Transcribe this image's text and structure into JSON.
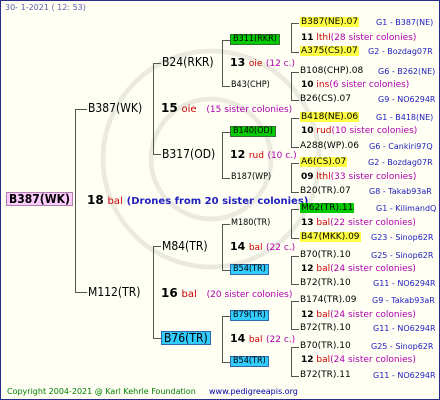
{
  "header": {
    "date": "30-  1-2021  ( 12: 53)"
  },
  "root": {
    "name": "B387(WK)",
    "color": "#ffccff"
  },
  "root_info": {
    "num": "18",
    "word": "bal",
    "note": "(Drones from 20 sister colonies)"
  },
  "gen1": [
    {
      "name": "B387(WK)",
      "num": "15",
      "word": "oie",
      "note": "(15 sister colonies)"
    },
    {
      "name": "M112(TR)",
      "num": "16",
      "word": "bal",
      "note": "(20 sister colonies)"
    }
  ],
  "gen2": [
    {
      "name": "B24(RKR)",
      "num": "13",
      "word": "oie",
      "note": "(12 c.)"
    },
    {
      "name": "B317(OD)",
      "num": "12",
      "word": "rud",
      "note": "(10 c.)"
    },
    {
      "name": "M84(TR)",
      "num": "14",
      "word": "bal",
      "note": "(22 c.)"
    },
    {
      "name": "B76(TR)",
      "num": "14",
      "word": "bal",
      "note": "(22 c.)"
    }
  ],
  "gen3": [
    {
      "name": "B311(RKR)",
      "color": "#00cc00"
    },
    {
      "name": "B43(CHP)"
    },
    {
      "name": "B140(OD)",
      "color": "#00cc00"
    },
    {
      "name": "B187(WP)"
    },
    {
      "name": "M180(TR)"
    },
    {
      "name": "B54(TR)",
      "color": "#33ccff"
    },
    {
      "name": "B79(TR)",
      "color": "#33ccff"
    },
    {
      "name": "B54(TR)",
      "color": "#33ccff"
    }
  ],
  "gen3_info": [
    {
      "num": "11",
      "word": "lthl",
      "note": "(28 sister colonies)"
    },
    {
      "num": "10",
      "word": "ins",
      "note": "(6 sister colonies)"
    },
    {
      "num": "10",
      "word": "rud",
      "note": "(10 sister colonies)"
    },
    {
      "num": "09",
      "word": "lthl",
      "note": "(33 sister colonies)"
    },
    {
      "num": "13",
      "word": "bal",
      "note": "(22 sister colonies)"
    },
    {
      "num": "12",
      "word": "bal",
      "note": "(24 sister colonies)"
    },
    {
      "num": "12",
      "word": "bal",
      "note": "(24 sister colonies)"
    },
    {
      "num": "12",
      "word": "bal",
      "note": "(24 sister colonies)"
    }
  ],
  "gen4": [
    {
      "name": "B387(NE).07",
      "code": "G1 - B387(NE)",
      "color": "#ffff44"
    },
    {
      "name": "A375(CS).07",
      "code": "G2 - Bozdag07R",
      "color": "#ffff44"
    },
    {
      "name": "B108(CHP).08",
      "code": "G6 - B262(NE)"
    },
    {
      "name": "B26(CS).07",
      "code": "G9 - NO6294R"
    },
    {
      "name": "B418(NE).06",
      "code": "G1 - B418(NE)",
      "color": "#ffff44"
    },
    {
      "name": "A288(WP).06",
      "code": "G6 - Cankiri97Q"
    },
    {
      "name": "A6(CS).07",
      "code": "G2 - Bozdag07R",
      "color": "#ffff44"
    },
    {
      "name": "B20(TR).07",
      "code": "G8 - Takab93aR"
    },
    {
      "name": "M62(TR).11",
      "code": "G1 - KilimandQ",
      "color": "#00cc00"
    },
    {
      "name": "B47(MKK).09",
      "code": "G23 - Sinop62R",
      "color": "#ffff44"
    },
    {
      "name": "B70(TR).10",
      "code": "G25 - Sinop62R"
    },
    {
      "name": "B72(TR).10",
      "code": "G11 - NO6294R"
    },
    {
      "name": "B174(TR).09",
      "code": "G9 - Takab93aR"
    },
    {
      "name": "B72(TR).10",
      "code": "G11 - NO6294R"
    },
    {
      "name": "B70(TR).10",
      "code": "G25 - Sinop62R"
    },
    {
      "name": "B72(TR).11",
      "code": "G11 - NO6294R"
    }
  ],
  "footer": {
    "copyright": "Copyright 2004-2021 @ Karl Kehrle Foundation",
    "url": "www.pedigreeapis.org"
  }
}
